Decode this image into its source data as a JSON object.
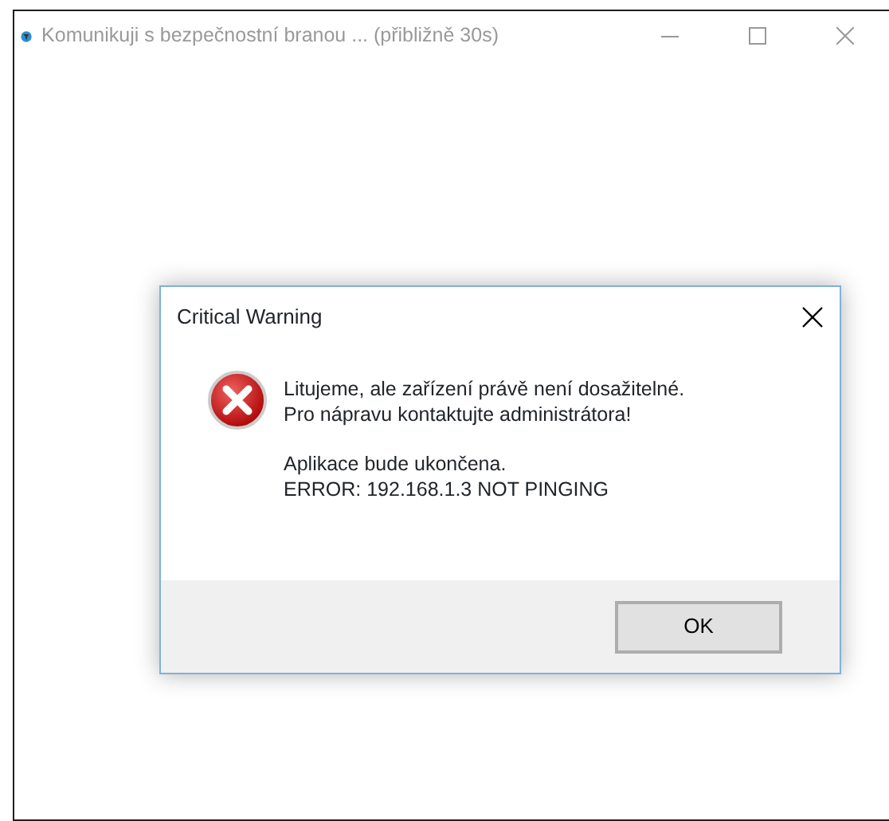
{
  "window": {
    "title": "Komunikuji s bezpečnostní branou ... (přibližně 30s)",
    "active": false
  },
  "dialog": {
    "title": "Critical Warning",
    "message_lines": [
      "Litujeme, ale zařízení právě není dosažitelné.",
      "Pro nápravu kontaktujte administrátora!"
    ],
    "detail_lines": [
      "Aplikace bude ukončena.",
      "ERROR: 192.168.1.3 NOT PINGING"
    ],
    "buttons": [
      "OK"
    ]
  }
}
